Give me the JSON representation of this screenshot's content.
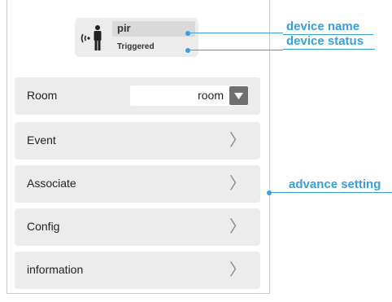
{
  "device": {
    "name": "pir",
    "status": "Triggered",
    "icon": "person-sensor-icon"
  },
  "rows": {
    "room": {
      "label": "Room",
      "value": "room"
    },
    "event": {
      "label": "Event"
    },
    "associate": {
      "label": "Associate"
    },
    "config": {
      "label": "Config"
    },
    "information": {
      "label": "information"
    }
  },
  "annotations": {
    "device_name": "device name",
    "device_status": "device status",
    "advance_setting": "advance setting"
  },
  "colors": {
    "accent": "#3c9ed8",
    "row_background": "#ececec",
    "dropdown_button": "#6f6f6f"
  }
}
